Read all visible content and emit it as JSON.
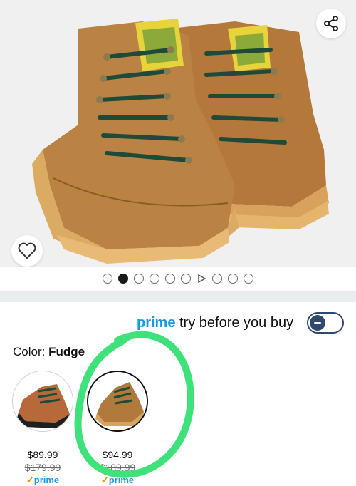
{
  "gallery": {
    "image_alt": "Brown nubuck hiking boots with green laces",
    "share_icon": "share-icon",
    "favorite_icon": "heart-icon",
    "dots_count": 10,
    "active_dot": 1,
    "video_dot_index": 6
  },
  "prime_try": {
    "prime_word": "prime",
    "label": "try before you buy",
    "toggle_on": false
  },
  "color": {
    "label": "Color:",
    "value": "Fudge"
  },
  "swatches": [
    {
      "price": "$89.99",
      "list_price": "$179.99",
      "prime": "prime",
      "selected": false
    },
    {
      "price": "$94.99",
      "list_price": "$189.99",
      "prime": "prime",
      "selected": true
    }
  ],
  "colors": {
    "prime_blue": "#1a98e0",
    "toggle_navy": "#2f4a6d",
    "annotation_green": "#3fe27a",
    "boot_brown": "#b07a3c",
    "lace_green": "#1f4a3a"
  }
}
